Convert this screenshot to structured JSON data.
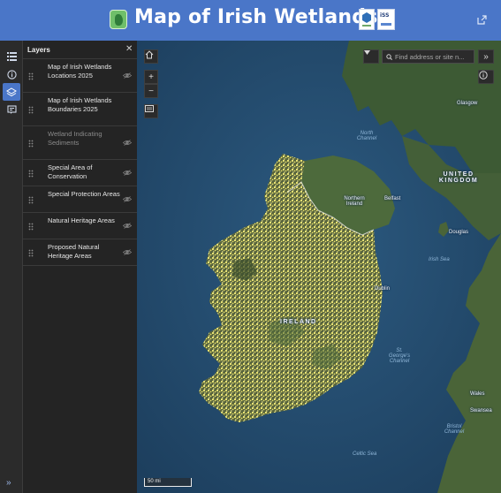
{
  "header": {
    "title": "Map of Irish Wetlands",
    "partner_logo_b_text": "iSS"
  },
  "panel": {
    "title": "Layers",
    "close_icon": "close-icon",
    "layers": [
      {
        "label": "Map of Irish Wetlands Locations 2025",
        "visible": false
      },
      {
        "label": "Map of Irish Wetlands Boundaries 2025",
        "visible": true
      },
      {
        "label": "Wetland Indicating Sediments",
        "visible": false
      },
      {
        "label": "Special Area of Conservation",
        "visible": false
      },
      {
        "label": "Special Protection Areas",
        "visible": false
      },
      {
        "label": "Natural Heritage Areas",
        "visible": false
      },
      {
        "label": "Proposed Natural Heritage Areas",
        "visible": false
      }
    ]
  },
  "rail": {
    "icons": [
      "list-icon",
      "info-icon",
      "layers-icon",
      "legend-icon"
    ],
    "active": "layers-icon",
    "expand_label": "»"
  },
  "map": {
    "search_placeholder": "Find address or site n...",
    "expand_label": "»",
    "zoom_in_label": "+",
    "zoom_out_label": "−",
    "scale_label": "50 mi",
    "place_labels": {
      "glasgow": "Glasgow",
      "north_channel": "North Channel",
      "northern_ireland": "Northern Ireland",
      "belfast": "Belfast",
      "united_kingdom": "UNITED KINGDOM",
      "douglas": "Douglas",
      "irish_sea": "Irish Sea",
      "dublin": "Dublin",
      "ireland": "IRELAND",
      "st_georges_channel": "St. George's Channel",
      "wales": "Wales",
      "swansea": "Swansea",
      "bristol_channel": "Bristol Channel",
      "celtic_sea": "Celtic Sea"
    }
  },
  "colors": {
    "header": "#4a76c8",
    "sea": "#234b6e",
    "land": "#3f5a32",
    "wetlands": "#f3ec79",
    "panel": "#242424"
  }
}
